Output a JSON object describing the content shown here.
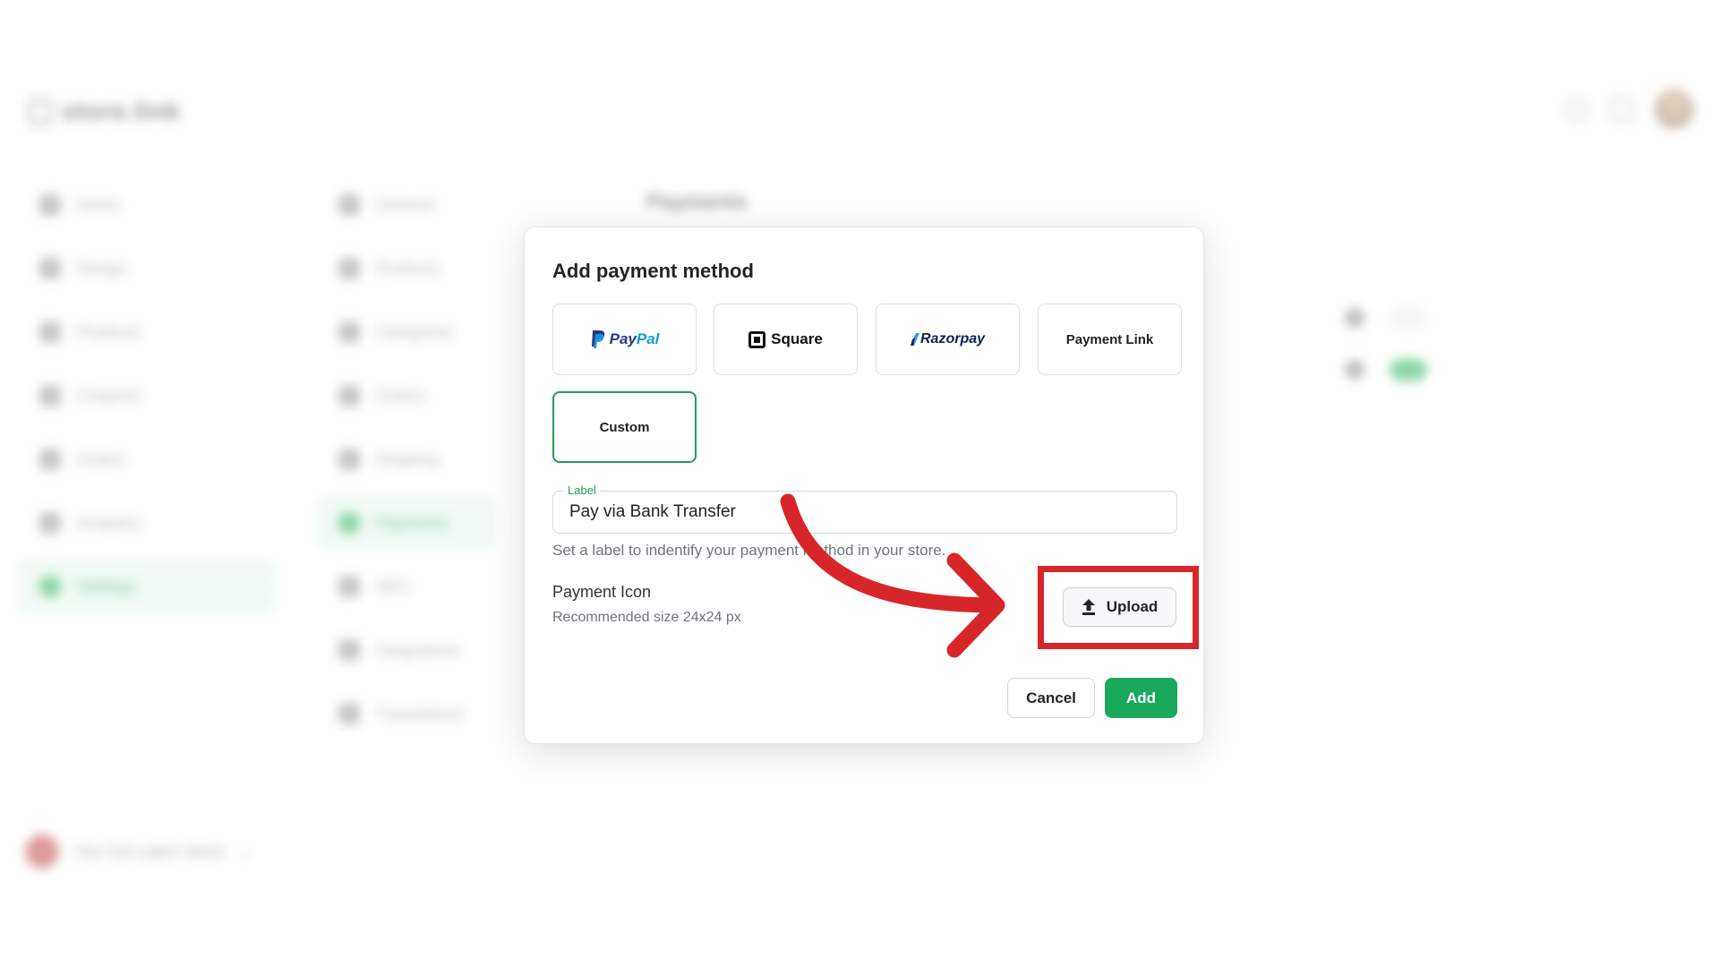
{
  "app": {
    "logo_text": "store.link",
    "nav_primary": [
      {
        "label": "Home",
        "active": false
      },
      {
        "label": "Design",
        "active": false
      },
      {
        "label": "Products",
        "active": false
      },
      {
        "label": "Coupons",
        "active": false
      },
      {
        "label": "Orders",
        "active": false
      },
      {
        "label": "Analytics",
        "active": false
      },
      {
        "label": "Settings",
        "active": true
      }
    ],
    "nav_settings": [
      {
        "label": "General",
        "active": false
      },
      {
        "label": "Products",
        "active": false
      },
      {
        "label": "Categories",
        "active": false
      },
      {
        "label": "Orders",
        "active": false
      },
      {
        "label": "Shipping",
        "active": false
      },
      {
        "label": "Payments",
        "active": true
      },
      {
        "label": "SEO",
        "active": false
      },
      {
        "label": "Integrations",
        "active": false
      },
      {
        "label": "Translations",
        "active": false
      }
    ],
    "page_title": "Payments",
    "store_name": "The Cat Lady's Store"
  },
  "modal": {
    "title": "Add payment method",
    "methods": [
      {
        "label": "PayPal",
        "label_part1": "Pay",
        "label_part2": "Pal",
        "icon": "paypal-logo",
        "selected": false
      },
      {
        "label": "Square",
        "icon": "square-logo",
        "selected": false
      },
      {
        "label": "Razorpay",
        "icon": "razorpay-logo",
        "selected": false
      },
      {
        "label": "Payment Link",
        "selected": false
      },
      {
        "label": "Custom",
        "selected": true
      }
    ],
    "label_field": {
      "label": "Label",
      "value": "Pay via Bank Transfer",
      "helper": "Set a label to indentify your payment method in your store."
    },
    "payment_icon": {
      "title": "Payment Icon",
      "subtitle": "Recommended size 24x24 px",
      "upload_label": "Upload",
      "upload_icon": "upload-icon"
    },
    "cancel_label": "Cancel",
    "add_label": "Add"
  },
  "colors": {
    "accent_green": "#1aa85a",
    "annotation_red": "#d7262a"
  }
}
